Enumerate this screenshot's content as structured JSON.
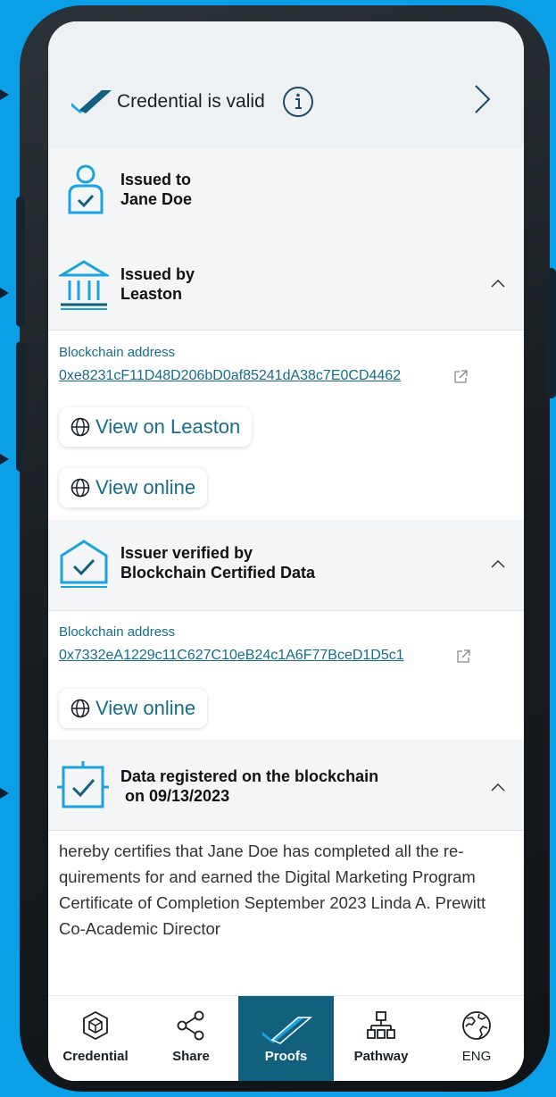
{
  "valid": {
    "text": "Credential is valid"
  },
  "issued_to": {
    "line1": "Issued to",
    "line2": "Jane Doe"
  },
  "issued_by": {
    "line1": "Issued by",
    "line2": "Leaston",
    "address_label": "Blockchain address",
    "address": "0xe8231cF11D48D206bD0af85241dA38c7E0CD4462",
    "view_leaston": "View on Leaston",
    "view_online": "View online"
  },
  "issuer_verified": {
    "line1": "Issuer verified by",
    "line2": "Blockchain Certified Data",
    "address_label": "Blockchain address",
    "address": "0x7332eA1229c11C627C10eB24c1A6F77BceD1D5c1",
    "view_online": "View online"
  },
  "registered": {
    "line1": "Data registered on the blockchain",
    "line2": "on 09/13/2023"
  },
  "description": "hereby certifies that Jane Doe has completed all the re- quirements for and earned the Digital Marketing Program Certificate of Completion September 2023 Linda A. Prewitt Co-Academic Director",
  "nav": [
    {
      "label": "Credential",
      "icon": "cube-icon"
    },
    {
      "label": "Share",
      "icon": "share-icon"
    },
    {
      "label": "Proofs",
      "icon": "check-icon",
      "active": true
    },
    {
      "label": "Pathway",
      "icon": "sitemap-icon"
    },
    {
      "label": "ENG",
      "icon": "globe-icon"
    }
  ],
  "colors": {
    "accent": "#11607e",
    "link": "#166c8a",
    "icon_blue": "#1aa3e0",
    "background": "#0a9fe6"
  }
}
